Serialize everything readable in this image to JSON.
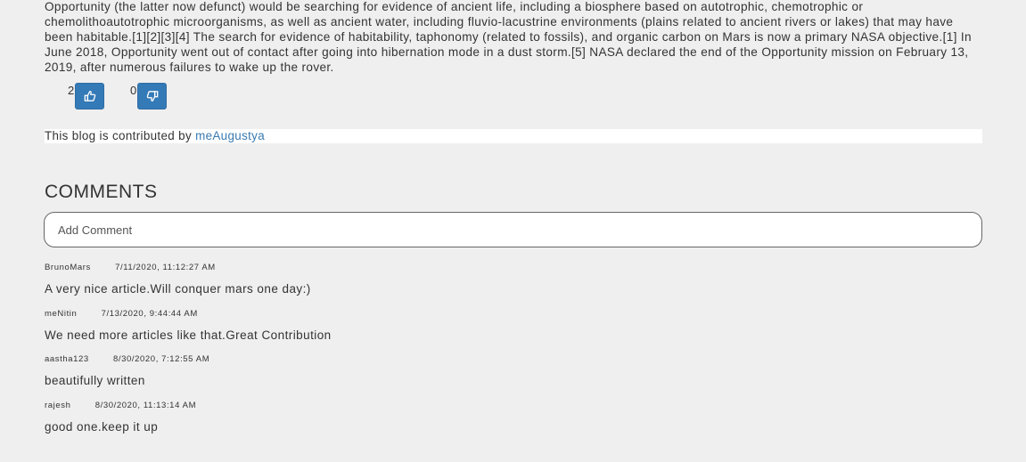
{
  "article": {
    "text": "Opportunity (the latter now defunct) would be searching for evidence of ancient life, including a biosphere based on autotrophic, chemotrophic or chemolithoautotrophic microorganisms, as well as ancient water, including fluvio-lacustrine environments (plains related to ancient rivers or lakes) that may have been habitable.[1][2][3][4] The search for evidence of habitability, taphonomy (related to fossils), and organic carbon on Mars is now a primary NASA objective.[1] In June 2018, Opportunity went out of contact after going into hibernation mode in a dust storm.[5] NASA declared the end of the Opportunity mission on February 13, 2019, after numerous failures to wake up the rover."
  },
  "votes": {
    "likes": "2",
    "dislikes": "0",
    "like_icon": "thumbs-up-icon",
    "dislike_icon": "thumbs-down-icon",
    "button_color": "#337ab7"
  },
  "contributor": {
    "prefix": "This blog is contributed by",
    "author": "meAugustya",
    "link_color": "#3a7ab0"
  },
  "comments_section": {
    "heading": "COMMENTS",
    "input_placeholder": "Add Comment",
    "input_value": ""
  },
  "comments": [
    {
      "user": "BrunoMars",
      "time": "7/11/2020, 11:12:27 AM",
      "text": "A very nice article.Will conquer mars one day:)"
    },
    {
      "user": "meNitin",
      "time": "7/13/2020, 9:44:44 AM",
      "text": "We need more articles like that.Great Contribution"
    },
    {
      "user": "aastha123",
      "time": "8/30/2020, 7:12:55 AM",
      "text": "beautifully written"
    },
    {
      "user": "rajesh",
      "time": "8/30/2020, 11:13:14 AM",
      "text": "good one.keep it up"
    }
  ]
}
